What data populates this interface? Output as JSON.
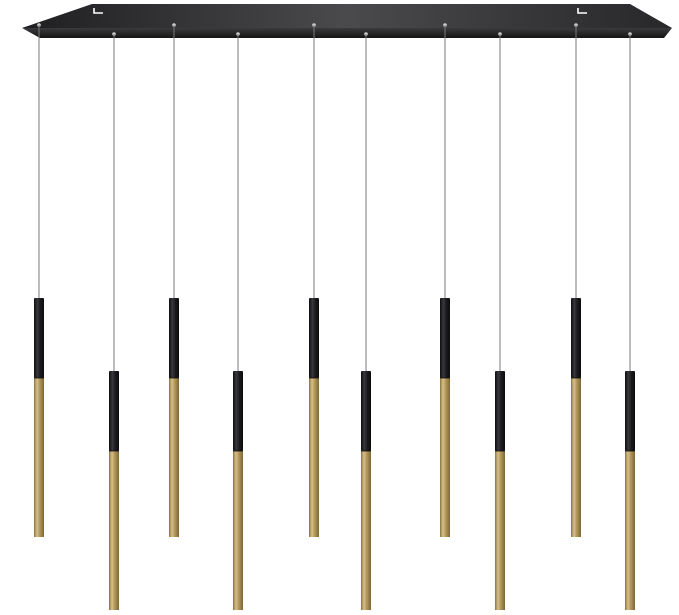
{
  "product": {
    "name": "",
    "canopy_color": "#2f2f31",
    "cable_color": "#7a7a7a",
    "tube_black_color": "#1d1d20",
    "tube_brass_color": "#b59a5c",
    "pendant_count": 10,
    "pendants": [
      {
        "row": "high"
      },
      {
        "row": "low"
      },
      {
        "row": "high"
      },
      {
        "row": "low"
      },
      {
        "row": "high"
      },
      {
        "row": "low"
      },
      {
        "row": "high"
      },
      {
        "row": "low"
      },
      {
        "row": "high"
      },
      {
        "row": "low"
      }
    ]
  }
}
